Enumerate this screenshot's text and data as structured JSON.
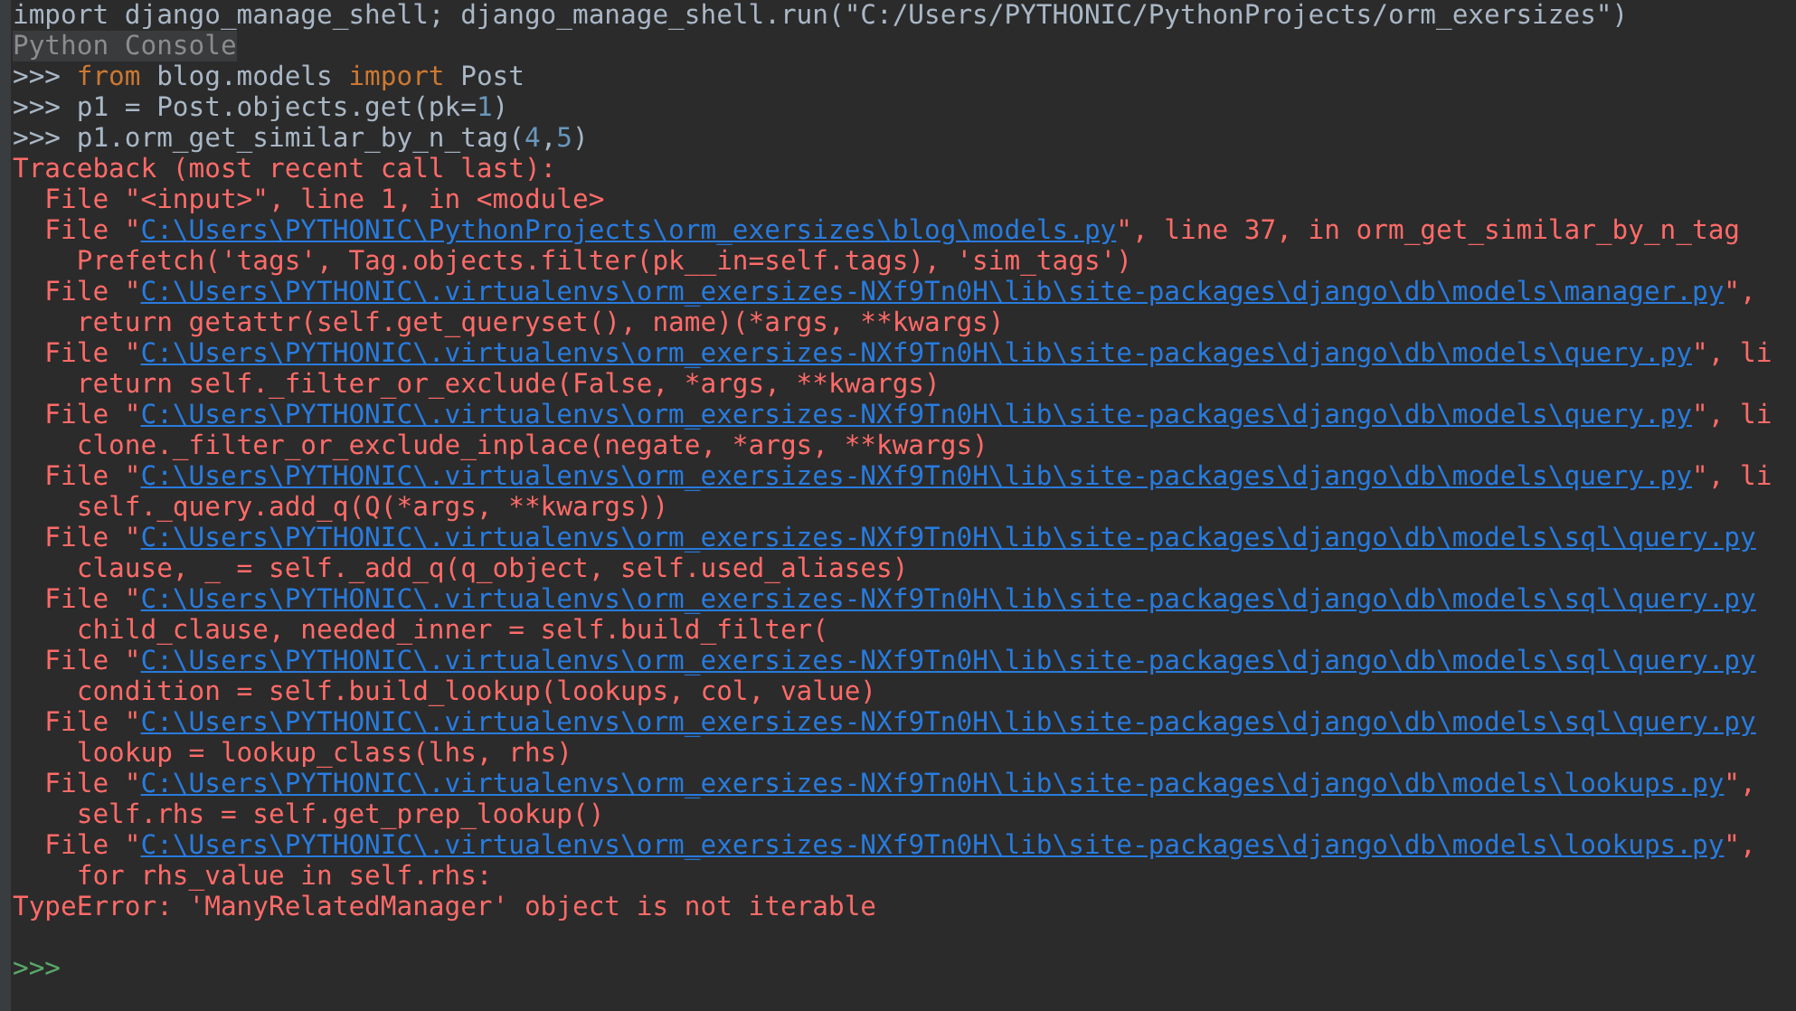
{
  "console": {
    "header_line": "import django_manage_shell; django_manage_shell.run(\"C:/Users/PYTHONIC/PythonProjects/orm_exersizes\")",
    "title": "Python Console",
    "lines": [
      {
        "kind": "input",
        "prompt": ">>>",
        "parts": [
          {
            "kind": "keyword",
            "text": "from"
          },
          {
            "kind": "plain",
            "text": " blog.models "
          },
          {
            "kind": "keyword",
            "text": "import"
          },
          {
            "kind": "plain",
            "text": " Post"
          }
        ]
      },
      {
        "kind": "input",
        "prompt": ">>>",
        "parts": [
          {
            "kind": "plain",
            "text": "p1 = Post.objects.get(pk="
          },
          {
            "kind": "number",
            "text": "1"
          },
          {
            "kind": "plain",
            "text": ")"
          }
        ]
      },
      {
        "kind": "input",
        "prompt": ">>>",
        "parts": [
          {
            "kind": "plain",
            "text": "p1.orm_get_similar_by_n_tag("
          },
          {
            "kind": "number",
            "text": "4"
          },
          {
            "kind": "plain",
            "text": ","
          },
          {
            "kind": "number",
            "text": "5"
          },
          {
            "kind": "plain",
            "text": ")"
          }
        ]
      },
      {
        "kind": "error",
        "text": "Traceback (most recent call last):"
      },
      {
        "kind": "code",
        "text": "  File \"<input>\", line 1, in <module>"
      },
      {
        "kind": "file",
        "prefix": "  File \"",
        "path": "C:\\Users\\PYTHONIC\\PythonProjects\\orm_exersizes\\blog\\models.py",
        "suffix": "\", line 37, in orm_get_similar_by_n_tag"
      },
      {
        "kind": "code",
        "text": "    Prefetch('tags', Tag.objects.filter(pk__in=self.tags), 'sim_tags')"
      },
      {
        "kind": "file",
        "prefix": "  File \"",
        "path": "C:\\Users\\PYTHONIC\\.virtualenvs\\orm_exersizes-NXf9Tn0H\\lib\\site-packages\\django\\db\\models\\manager.py",
        "suffix": "\","
      },
      {
        "kind": "code",
        "text": "    return getattr(self.get_queryset(), name)(*args, **kwargs)"
      },
      {
        "kind": "file",
        "prefix": "  File \"",
        "path": "C:\\Users\\PYTHONIC\\.virtualenvs\\orm_exersizes-NXf9Tn0H\\lib\\site-packages\\django\\db\\models\\query.py",
        "suffix": "\", li"
      },
      {
        "kind": "code",
        "text": "    return self._filter_or_exclude(False, *args, **kwargs)"
      },
      {
        "kind": "file",
        "prefix": "  File \"",
        "path": "C:\\Users\\PYTHONIC\\.virtualenvs\\orm_exersizes-NXf9Tn0H\\lib\\site-packages\\django\\db\\models\\query.py",
        "suffix": "\", li"
      },
      {
        "kind": "code",
        "text": "    clone._filter_or_exclude_inplace(negate, *args, **kwargs)"
      },
      {
        "kind": "file",
        "prefix": "  File \"",
        "path": "C:\\Users\\PYTHONIC\\.virtualenvs\\orm_exersizes-NXf9Tn0H\\lib\\site-packages\\django\\db\\models\\query.py",
        "suffix": "\", li"
      },
      {
        "kind": "code",
        "text": "    self._query.add_q(Q(*args, **kwargs))"
      },
      {
        "kind": "file",
        "prefix": "  File \"",
        "path": "C:\\Users\\PYTHONIC\\.virtualenvs\\orm_exersizes-NXf9Tn0H\\lib\\site-packages\\django\\db\\models\\sql\\query.py"
      },
      {
        "kind": "code",
        "text": "    clause, _ = self._add_q(q_object, self.used_aliases)"
      },
      {
        "kind": "file",
        "prefix": "  File \"",
        "path": "C:\\Users\\PYTHONIC\\.virtualenvs\\orm_exersizes-NXf9Tn0H\\lib\\site-packages\\django\\db\\models\\sql\\query.py"
      },
      {
        "kind": "code",
        "text": "    child_clause, needed_inner = self.build_filter("
      },
      {
        "kind": "file",
        "prefix": "  File \"",
        "path": "C:\\Users\\PYTHONIC\\.virtualenvs\\orm_exersizes-NXf9Tn0H\\lib\\site-packages\\django\\db\\models\\sql\\query.py"
      },
      {
        "kind": "code",
        "text": "    condition = self.build_lookup(lookups, col, value)"
      },
      {
        "kind": "file",
        "prefix": "  File \"",
        "path": "C:\\Users\\PYTHONIC\\.virtualenvs\\orm_exersizes-NXf9Tn0H\\lib\\site-packages\\django\\db\\models\\sql\\query.py"
      },
      {
        "kind": "code",
        "text": "    lookup = lookup_class(lhs, rhs)"
      },
      {
        "kind": "file",
        "prefix": "  File \"",
        "path": "C:\\Users\\PYTHONIC\\.virtualenvs\\orm_exersizes-NXf9Tn0H\\lib\\site-packages\\django\\db\\models\\lookups.py",
        "suffix": "\","
      },
      {
        "kind": "code",
        "text": "    self.rhs = self.get_prep_lookup()"
      },
      {
        "kind": "file",
        "prefix": "  File \"",
        "path": "C:\\Users\\PYTHONIC\\.virtualenvs\\orm_exersizes-NXf9Tn0H\\lib\\site-packages\\django\\db\\models\\lookups.py",
        "suffix": "\","
      },
      {
        "kind": "code",
        "text": "    for rhs_value in self.rhs:"
      },
      {
        "kind": "error",
        "text": "TypeError: 'ManyRelatedManager' object is not iterable"
      },
      {
        "kind": "blank"
      },
      {
        "kind": "prompt",
        "prompt": ">>>"
      }
    ]
  }
}
